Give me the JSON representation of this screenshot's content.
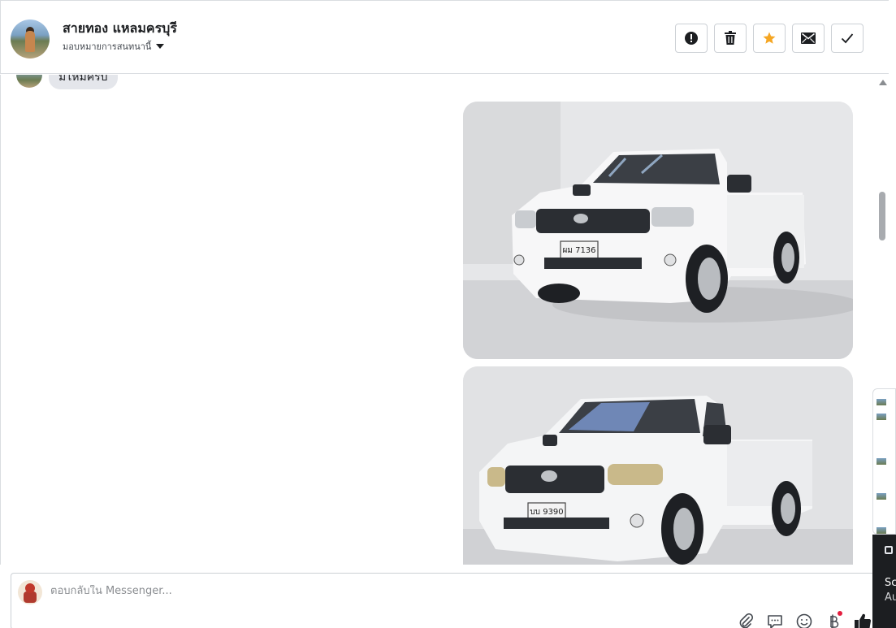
{
  "header": {
    "contact_name": "สายทอง แหลมครบุรี",
    "assign_label": "มอบหมายการสนทนานี้",
    "actions": [
      {
        "name": "spam-icon",
        "label": "!"
      },
      {
        "name": "trash-icon",
        "label": ""
      },
      {
        "name": "star-icon",
        "label": ""
      },
      {
        "name": "envelope-icon",
        "label": ""
      },
      {
        "name": "check-icon",
        "label": ""
      }
    ],
    "star_color": "#f5a623"
  },
  "chat": {
    "incoming_message": "มีไหมครับ",
    "photos": [
      {
        "plate": "ผม 7136",
        "desc": "white pickup truck"
      },
      {
        "plate": "บบ 9390",
        "desc": "white pickup truck"
      }
    ]
  },
  "reply": {
    "placeholder": "ตอบกลับใน Messenger...",
    "tools": [
      "paperclip-icon",
      "chat-bubble-icon",
      "emoji-icon",
      "baht-icon",
      "thumbs-up-icon"
    ]
  },
  "side": {
    "line1": "Sc",
    "line2": "Au"
  }
}
